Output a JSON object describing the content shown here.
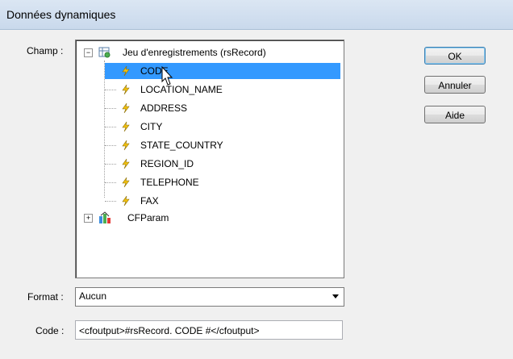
{
  "window": {
    "title": "Données dynamiques"
  },
  "labels": {
    "champ": "Champ :",
    "format": "Format :",
    "code": "Code :"
  },
  "tree": {
    "root": {
      "label": "Jeu d'enregistrements (rsRecord)",
      "expanded": true,
      "icon": "recordset-icon"
    },
    "fields": [
      "CODE",
      "LOCATION_NAME",
      "ADDRESS",
      "CITY",
      "STATE_COUNTRY",
      "REGION_ID",
      "TELEPHONE",
      "FAX"
    ],
    "selected_index": 0,
    "field_icon": "lightning-bolt-icon",
    "second_root": {
      "label": "CFParam",
      "expanded": false,
      "icon": "server-variables-icon"
    }
  },
  "buttons": {
    "ok": "OK",
    "cancel": "Annuler",
    "help": "Aide"
  },
  "format": {
    "value": "Aucun"
  },
  "code": {
    "value": "<cfoutput>#rsRecord. CODE #</cfoutput>"
  },
  "colors": {
    "selection": "#3399ff",
    "bolt": "#f4c20d",
    "titlebar": "#c9d9ec"
  }
}
